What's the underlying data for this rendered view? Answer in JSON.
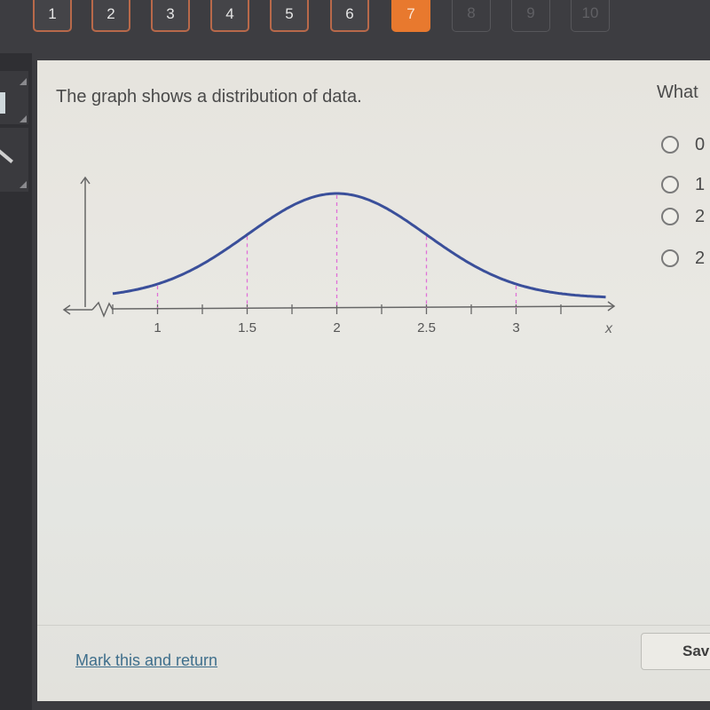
{
  "nav": {
    "questions": [
      {
        "label": "1",
        "state": "answered"
      },
      {
        "label": "2",
        "state": "answered"
      },
      {
        "label": "3",
        "state": "answered"
      },
      {
        "label": "4",
        "state": "answered"
      },
      {
        "label": "5",
        "state": "answered"
      },
      {
        "label": "6",
        "state": "answered"
      },
      {
        "label": "7",
        "state": "current"
      },
      {
        "label": "8",
        "state": "disabled"
      },
      {
        "label": "9",
        "state": "disabled"
      },
      {
        "label": "10",
        "state": "disabled"
      }
    ],
    "accent_color": "#e8792e"
  },
  "prompt": "The graph shows a distribution of data.",
  "question": "What",
  "options": [
    {
      "label": "0"
    },
    {
      "label": "1"
    },
    {
      "label": "2"
    },
    {
      "label": "2"
    }
  ],
  "footer": {
    "mark_link": "Mark this and return",
    "save_label": "Sav"
  },
  "chart_data": {
    "type": "line",
    "title": "",
    "xlabel": "x",
    "ylabel": "",
    "description": "Normal distribution curve",
    "mean": 2,
    "std_dev": 0.5,
    "xlim": [
      0.75,
      3.5
    ],
    "x_ticks": [
      0.75,
      1,
      1.25,
      1.5,
      1.75,
      2,
      2.25,
      2.5,
      2.75,
      3,
      3.25
    ],
    "x_tick_labels": [
      "1",
      "1.5",
      "2",
      "2.5",
      "3"
    ],
    "x_tick_label_values": [
      1,
      1.5,
      2,
      2.5,
      3
    ],
    "reference_lines_x": [
      1,
      1.5,
      2,
      2.5,
      3
    ],
    "curve_color": "#3a4f9a",
    "reference_line_color": "#e070d8",
    "axis_break": true
  }
}
